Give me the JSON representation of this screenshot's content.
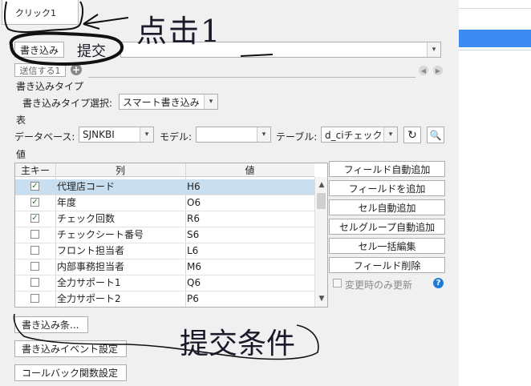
{
  "top_tab": {
    "label": "クリック1"
  },
  "handwriting": {
    "click_note": "点击1",
    "submit_note": "提交",
    "condition_note": "提交条件"
  },
  "toolbar": {
    "write_tab": "書き込み",
    "send_tab": "送信する1"
  },
  "write_type": {
    "section": "書き込みタイプ",
    "select_label": "書き込みタイプ選択:",
    "select_value": "スマート書き込み"
  },
  "table_section": {
    "section": "表",
    "db_label": "データベース:",
    "db_value": "SJNKBI",
    "model_label": "モデル:",
    "model_value": "",
    "table_label": "テーブル:",
    "table_value": "d_ciチェック"
  },
  "values": {
    "section": "値",
    "columns": {
      "key": "主キー",
      "column": "列",
      "value": "値"
    },
    "rows": [
      {
        "checked": true,
        "column": "代理店コード",
        "value": "H6"
      },
      {
        "checked": true,
        "column": "年度",
        "value": "O6"
      },
      {
        "checked": true,
        "column": "チェック回数",
        "value": "R6"
      },
      {
        "checked": false,
        "column": "チェックシート番号",
        "value": "S6"
      },
      {
        "checked": false,
        "column": "フロント担当者",
        "value": "L6"
      },
      {
        "checked": false,
        "column": "内部事務担当者",
        "value": "M6"
      },
      {
        "checked": false,
        "column": "全力サポート1",
        "value": "Q6"
      },
      {
        "checked": false,
        "column": "全力サポート2",
        "value": "P6"
      }
    ]
  },
  "side_buttons": {
    "auto_field": "フィールド自動追加",
    "add_field": "フィールドを追加",
    "auto_cell": "セル自動追加",
    "auto_cell_group": "セルグループ自動追加",
    "cell_bulk_edit": "セル一括編集",
    "delete_field": "フィールド削除",
    "changed_only": "変更時のみ更新"
  },
  "bottom_buttons": {
    "write_condition": "書き込み条...",
    "write_event": "書き込みイベント設定",
    "callback": "コールバック関数設定"
  },
  "colors": {
    "selected_row": "#c9dff0",
    "accent_blue": "#3d8bf2",
    "check_green": "#1b7a1b"
  }
}
